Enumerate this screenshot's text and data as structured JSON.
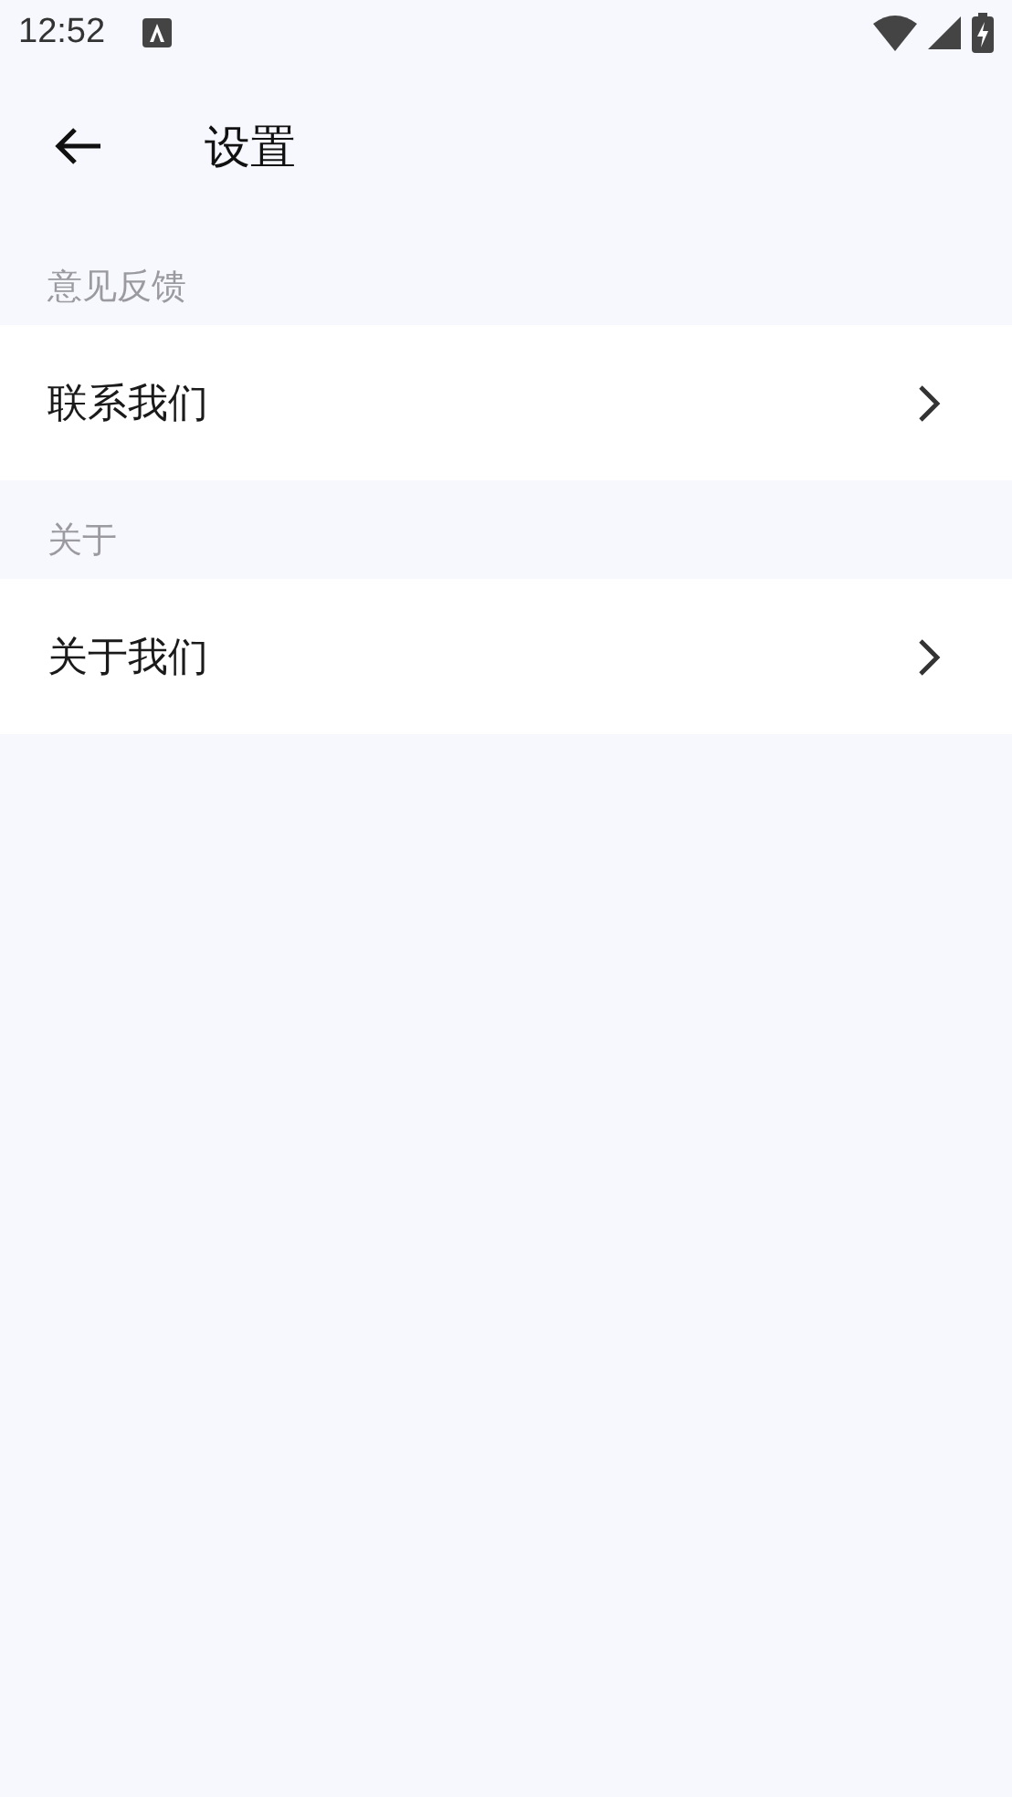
{
  "status_bar": {
    "time": "12:52"
  },
  "header": {
    "title": "设置"
  },
  "sections": [
    {
      "title": "意见反馈",
      "items": [
        {
          "label": "联系我们"
        }
      ]
    },
    {
      "title": "关于",
      "items": [
        {
          "label": "关于我们"
        }
      ]
    }
  ]
}
